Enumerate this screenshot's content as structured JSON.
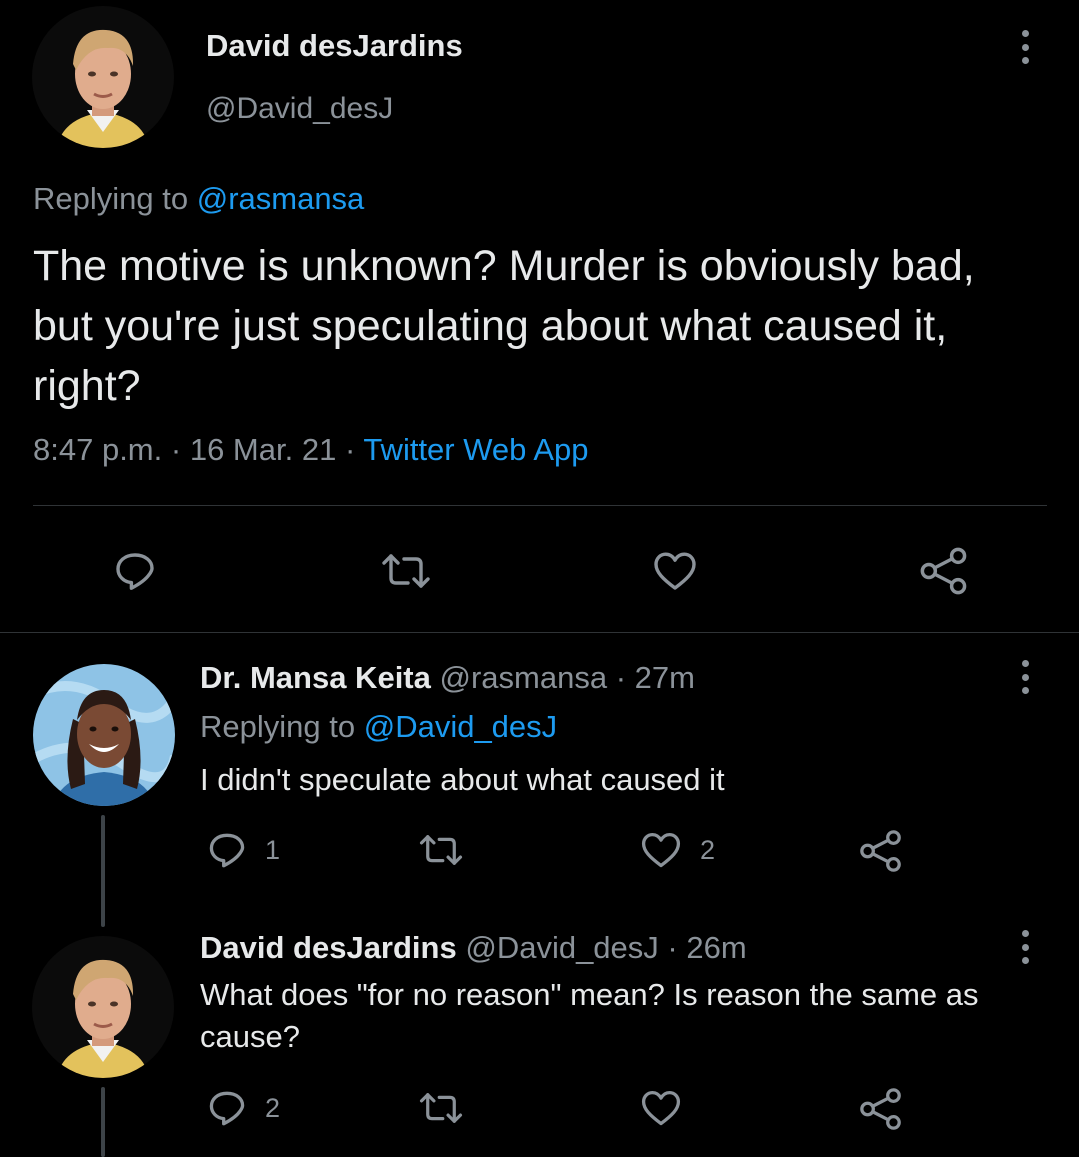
{
  "colors": {
    "background": "#000000",
    "primary_text": "#e7e9ea",
    "secondary_text": "#8b9299",
    "accent": "#1d9bf0",
    "divider": "#2f3336"
  },
  "main_tweet": {
    "author_name": "David desJardins",
    "author_handle": "@David_desJ",
    "replying_to_prefix": "Replying to",
    "replying_to_handle": "@rasmansa",
    "text": "The motive is unknown? Murder is obviously bad, but you're just speculating about what caused it, right?",
    "time": "8:47 p.m.",
    "date": "16 Mar. 21",
    "separator": "·",
    "source": "Twitter Web App",
    "icons": [
      "reply-icon",
      "retweet-icon",
      "like-icon",
      "share-icon",
      "more-icon"
    ]
  },
  "replies": [
    {
      "author_name": "Dr. Mansa Keita",
      "author_handle": "@rasmansa",
      "separator": "·",
      "age": "27m",
      "replying_to_prefix": "Replying to",
      "replying_to_handle": "@David_desJ",
      "text": "I didn't speculate about what caused it",
      "reply_count": "1",
      "like_count": "2"
    },
    {
      "author_name": "David desJardins",
      "author_handle": "@David_desJ",
      "separator": "·",
      "age": "26m",
      "text": "What does \"for no reason\" mean? Is reason the same as cause?",
      "reply_count": "2"
    }
  ]
}
